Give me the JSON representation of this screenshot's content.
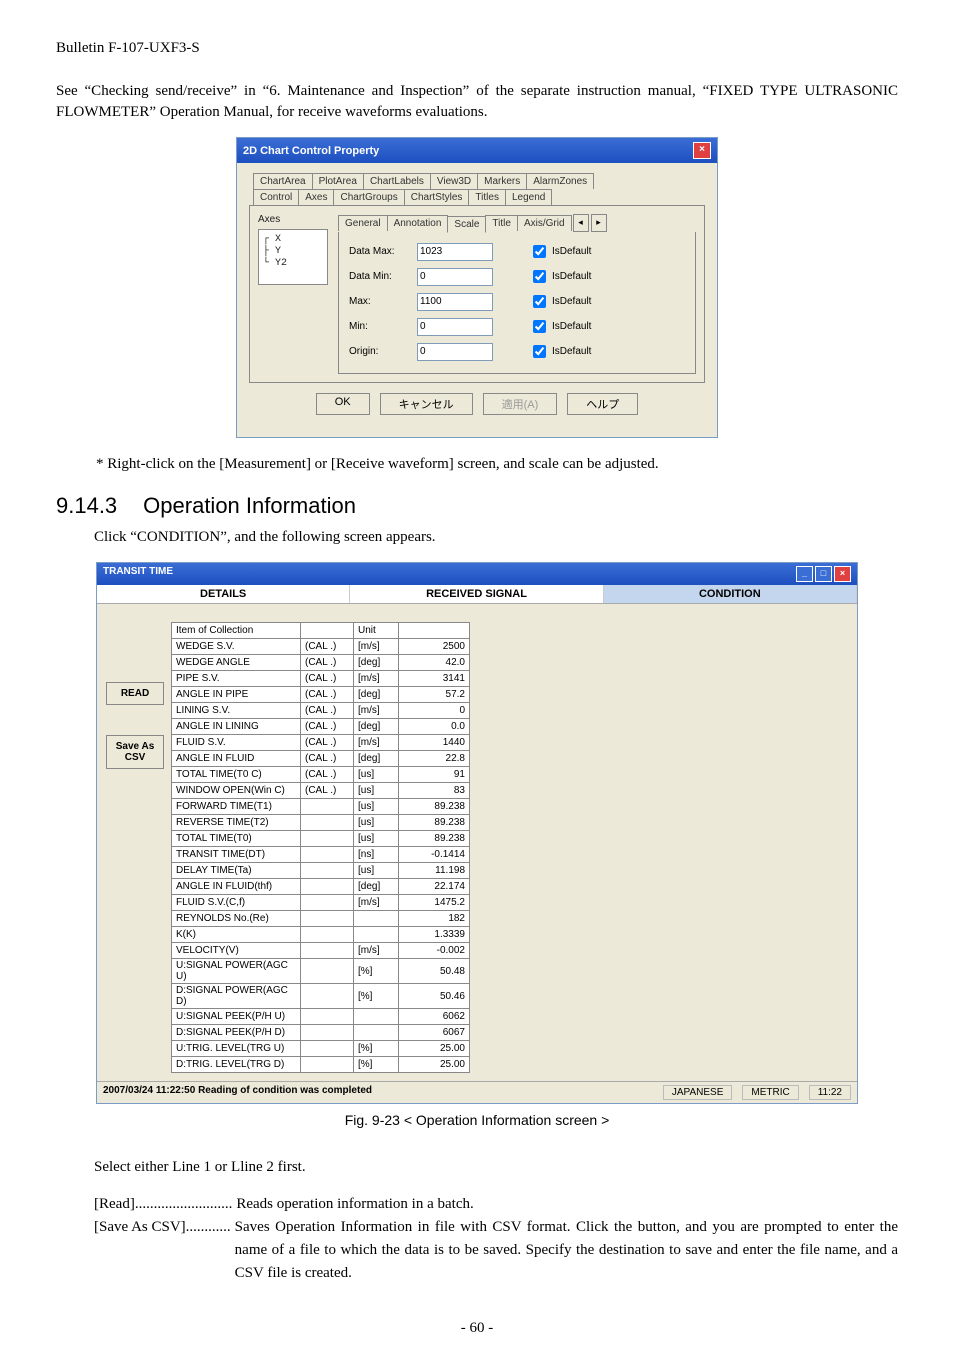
{
  "bulletin": "Bulletin F-107-UXF3-S",
  "intro": "See “Checking send/receive” in “6. Maintenance and Inspection” of the separate instruction manual, “FIXED TYPE ULTRASONIC FLOWMETER” Operation Manual, for receive waveforms evaluations.",
  "dialog": {
    "title": "2D Chart Control Property",
    "tabs_row1": [
      "ChartArea",
      "PlotArea",
      "ChartLabels",
      "View3D",
      "Markers",
      "AlarmZones"
    ],
    "tabs_row2": [
      "Control",
      "Axes",
      "ChartGroups",
      "ChartStyles",
      "Titles",
      "Legend"
    ],
    "axes_label": "Axes",
    "tree": {
      "l1": "X",
      "l2": "Y",
      "l3": "Y2"
    },
    "inner_tabs": [
      "General",
      "Annotation",
      "Scale",
      "Title",
      "Axis/Grid"
    ],
    "fields": [
      {
        "label": "Data Max:",
        "value": "1023",
        "chk": "IsDefault"
      },
      {
        "label": "Data Min:",
        "value": "0",
        "chk": "IsDefault"
      },
      {
        "label": "Max:",
        "value": "1100",
        "chk": "IsDefault"
      },
      {
        "label": "Min:",
        "value": "0",
        "chk": "IsDefault"
      },
      {
        "label": "Origin:",
        "value": "0",
        "chk": "IsDefault"
      }
    ],
    "buttons": {
      "ok": "OK",
      "cancel": "キャンセル",
      "apply": "適用(A)",
      "help": "ヘルプ"
    }
  },
  "note": "* Right-click on the [Measurement] or [Receive waveform] screen, and scale can be adjusted.",
  "section": {
    "num": "9.14.3",
    "title": "Operation Information"
  },
  "clickline": "Click “CONDITION”, and the following screen appears.",
  "transit": {
    "title": "TRANSIT TIME",
    "tabs": [
      "DETAILS",
      "RECEIVED SIGNAL",
      "CONDITION"
    ],
    "left": {
      "read": "READ",
      "save": "Save As\nCSV"
    },
    "header": {
      "item": "Item of Collection",
      "unit": "Unit",
      "val": ""
    },
    "rows": [
      {
        "c1": "WEDGE S.V.",
        "c2": "(CAL .)",
        "c3": "[m/s]",
        "c4": "2500"
      },
      {
        "c1": "WEDGE ANGLE",
        "c2": "(CAL .)",
        "c3": "[deg]",
        "c4": "42.0"
      },
      {
        "c1": "PIPE S.V.",
        "c2": "(CAL .)",
        "c3": "[m/s]",
        "c4": "3141"
      },
      {
        "c1": "ANGLE IN PIPE",
        "c2": "(CAL .)",
        "c3": "[deg]",
        "c4": "57.2"
      },
      {
        "c1": "LINING S.V.",
        "c2": "(CAL .)",
        "c3": "[m/s]",
        "c4": "0"
      },
      {
        "c1": "ANGLE IN LINING",
        "c2": "(CAL .)",
        "c3": "[deg]",
        "c4": "0.0"
      },
      {
        "c1": "FLUID S.V.",
        "c2": "(CAL .)",
        "c3": "[m/s]",
        "c4": "1440"
      },
      {
        "c1": "ANGLE IN FLUID",
        "c2": "(CAL .)",
        "c3": "[deg]",
        "c4": "22.8"
      },
      {
        "c1": "TOTAL TIME(T0 C)",
        "c2": "(CAL .)",
        "c3": "[us]",
        "c4": "91"
      },
      {
        "c1": "WINDOW OPEN(Win C)",
        "c2": "(CAL .)",
        "c3": "[us]",
        "c4": "83"
      },
      {
        "c1": "FORWARD TIME(T1)",
        "c2": "",
        "c3": "[us]",
        "c4": "89.238"
      },
      {
        "c1": "REVERSE TIME(T2)",
        "c2": "",
        "c3": "[us]",
        "c4": "89.238"
      },
      {
        "c1": "TOTAL TIME(T0)",
        "c2": "",
        "c3": "[us]",
        "c4": "89.238"
      },
      {
        "c1": "TRANSIT TIME(DT)",
        "c2": "",
        "c3": "[ns]",
        "c4": "-0.1414"
      },
      {
        "c1": "DELAY TIME(Ta)",
        "c2": "",
        "c3": "[us]",
        "c4": "11.198"
      },
      {
        "c1": "ANGLE IN FLUID(thf)",
        "c2": "",
        "c3": "[deg]",
        "c4": "22.174"
      },
      {
        "c1": "FLUID S.V.(C,f)",
        "c2": "",
        "c3": "[m/s]",
        "c4": "1475.2"
      },
      {
        "c1": "REYNOLDS No.(Re)",
        "c2": "",
        "c3": "",
        "c4": "182"
      },
      {
        "c1": "K(K)",
        "c2": "",
        "c3": "",
        "c4": "1.3339"
      },
      {
        "c1": "VELOCITY(V)",
        "c2": "",
        "c3": "[m/s]",
        "c4": "-0.002"
      },
      {
        "c1": "U:SIGNAL POWER(AGC U)",
        "c2": "",
        "c3": "[%]",
        "c4": "50.48"
      },
      {
        "c1": "D:SIGNAL POWER(AGC D)",
        "c2": "",
        "c3": "[%]",
        "c4": "50.46"
      },
      {
        "c1": "U:SIGNAL PEEK(P/H U)",
        "c2": "",
        "c3": "",
        "c4": "6062"
      },
      {
        "c1": "D:SIGNAL PEEK(P/H D)",
        "c2": "",
        "c3": "",
        "c4": "6067"
      },
      {
        "c1": "U:TRIG. LEVEL(TRG U)",
        "c2": "",
        "c3": "[%]",
        "c4": "25.00"
      },
      {
        "c1": "D:TRIG. LEVEL(TRG D)",
        "c2": "",
        "c3": "[%]",
        "c4": "25.00"
      }
    ],
    "status": {
      "left": "2007/03/24 11:22:50 Reading of condition was completed",
      "lang": "JAPANESE",
      "unit": "METRIC",
      "time": "11:22"
    }
  },
  "figcap": "Fig. 9-23 < Operation Information screen >",
  "select_line": "Select either Line 1 or Lline 2 first.",
  "desc": {
    "read": {
      "label": "[Read]",
      "body": "Reads operation information in a batch."
    },
    "save": {
      "label": "[Save As CSV]",
      "body": "Saves Operation Information in file with CSV format.  Click the button, and you are prompted to enter the name of a file to which the data is to be saved.  Specify the destination to save and enter the file name, and a CSV file is created."
    }
  },
  "pagenum": "- 60 -"
}
